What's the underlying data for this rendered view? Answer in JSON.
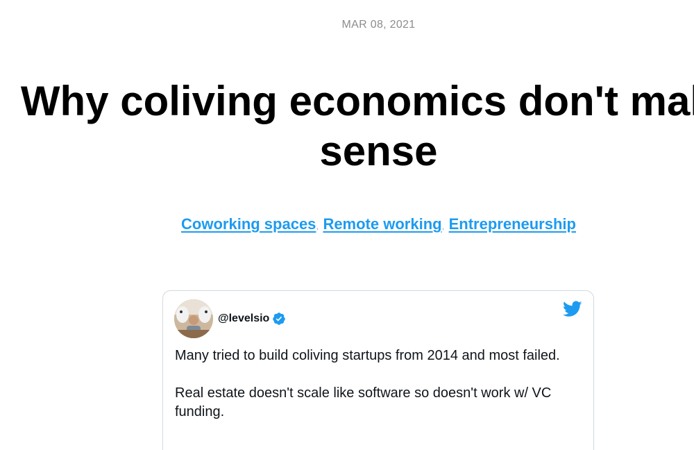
{
  "post": {
    "date": "MAR 08, 2021",
    "title": "Why coliving economics don't make sense",
    "tags": [
      {
        "label": "Coworking spaces"
      },
      {
        "label": "Remote working"
      },
      {
        "label": "Entrepreneurship"
      }
    ],
    "tag_separator": ","
  },
  "tweet": {
    "handle": "@levelsio",
    "paragraphs": [
      "Many tried to build coliving startups from 2014 and most failed.",
      "Real estate doesn't scale like software so doesn't work w/ VC funding."
    ],
    "icons": {
      "verified": "verified-badge-icon",
      "brand": "twitter-bird-icon"
    }
  },
  "colors": {
    "link": "#1d9bf0",
    "date": "#8c8c8c",
    "border": "#cfd9de"
  }
}
